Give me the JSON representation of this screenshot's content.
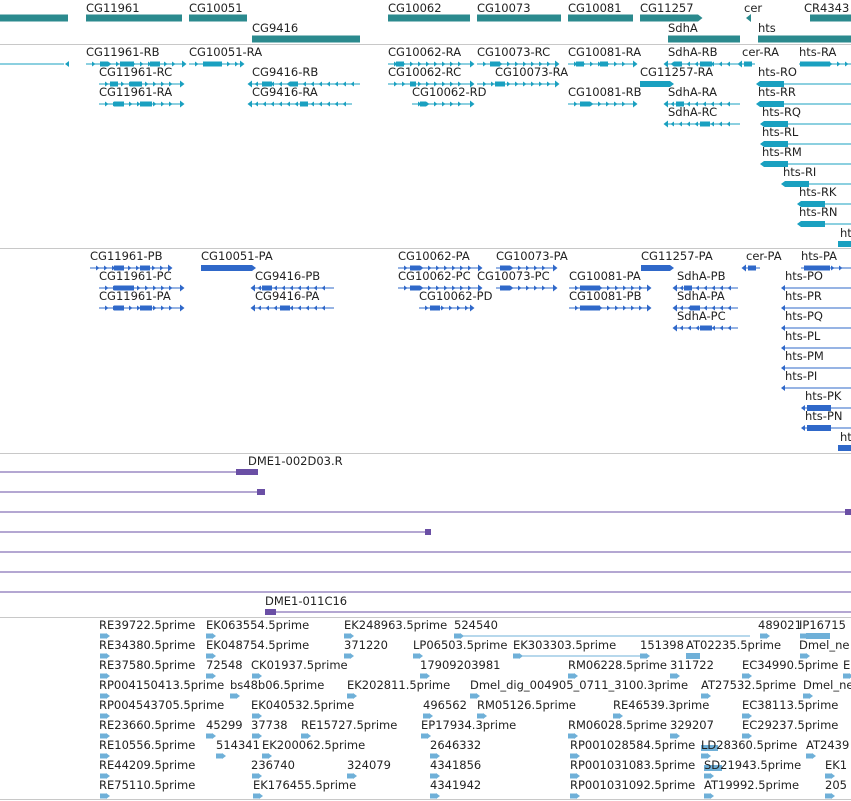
{
  "colors": {
    "gene": "#2b8a8e",
    "transcript_a": "#1aa0c0",
    "transcript_b": "#2f68c9",
    "clone": "#6a4fa5",
    "est": "#6fb0d8",
    "divider": "#c8c8c8"
  },
  "genes": [
    "CG11961",
    "CG10051",
    "CG9416",
    "CG10062",
    "CG10073",
    "CG10081",
    "CG11257",
    "SdhA",
    "cer",
    "hts",
    "CR4343"
  ],
  "transcripts_a": [
    "CG11961-RB",
    "CG11961-RC",
    "CG11961-RA",
    "CG10051-RA",
    "CG9416-RB",
    "CG9416-RA",
    "CG10062-RA",
    "CG10062-RC",
    "CG10062-RD",
    "CG10073-RC",
    "CG10073-RA",
    "CG10081-RA",
    "CG10081-RB",
    "CG11257-RA",
    "SdhA-RB",
    "SdhA-RA",
    "SdhA-RC",
    "cer-RA",
    "hts-RA",
    "hts-RO",
    "hts-RR",
    "hts-RQ",
    "hts-RL",
    "hts-RM",
    "hts-RI",
    "hts-RK",
    "hts-RN",
    "ht"
  ],
  "transcripts_b": [
    "CG11961-PB",
    "CG11961-PC",
    "CG11961-PA",
    "CG10051-PA",
    "CG9416-PB",
    "CG9416-PA",
    "CG10062-PA",
    "CG10062-PC",
    "CG10062-PD",
    "CG10073-PA",
    "CG10073-PC",
    "CG10081-PA",
    "CG10081-PB",
    "CG11257-PA",
    "SdhA-PB",
    "SdhA-PA",
    "SdhA-PC",
    "cer-PA",
    "hts-PA",
    "hts-PO",
    "hts-PR",
    "hts-PQ",
    "hts-PL",
    "hts-PM",
    "hts-PI",
    "hts-PK",
    "hts-PN",
    "ht"
  ],
  "clones": [
    "DME1-002D03.R",
    "DME1-011C16"
  ],
  "ests": [
    "RE39722.5prime",
    "EK063554.5prime",
    "EK248963.5prime",
    "524540",
    "489021",
    "IP16715",
    "RE34380.5prime",
    "EK048754.5prime",
    "371220",
    "LP06503.5prime",
    "EK303303.5prime",
    "151398",
    "AT02235.5prime",
    "Dmel_ne",
    "RE37580.5prime",
    "72548",
    "CK01937.5prime",
    "17909203981",
    "RM06228.5prime",
    "311722",
    "EC34990.5prime",
    "E",
    "RP004150413.5prime",
    "bs48b06.5prime",
    "EK202811.5prime",
    "Dmel_dig_004905_0711_3100.3prime",
    "AT27532.5prime",
    "Dmel_ne",
    "RP004543705.5prime",
    "EK040532.5prime",
    "496562",
    "RM05126.5prime",
    "RE46539.3prime",
    "EC38113.5prime",
    "RE23660.5prime",
    "45299",
    "37738",
    "RE15727.5prime",
    "EP17934.3prime",
    "RM06028.5prime",
    "329207",
    "EC29237.5prime",
    "RE10556.5prime",
    "514341",
    "EK200062.5prime",
    "2646332",
    "RP001028584.5prime",
    "LD28360.5prime",
    "AT2439",
    "RE44209.5prime",
    "236740",
    "324079",
    "4341856",
    "RP001031083.5prime",
    "SD21943.5prime",
    "EK1",
    "RE75110.5prime",
    "EK176455.5prime",
    "4341942",
    "RP001031092.5prime",
    "AT19992.5prime",
    "205"
  ]
}
